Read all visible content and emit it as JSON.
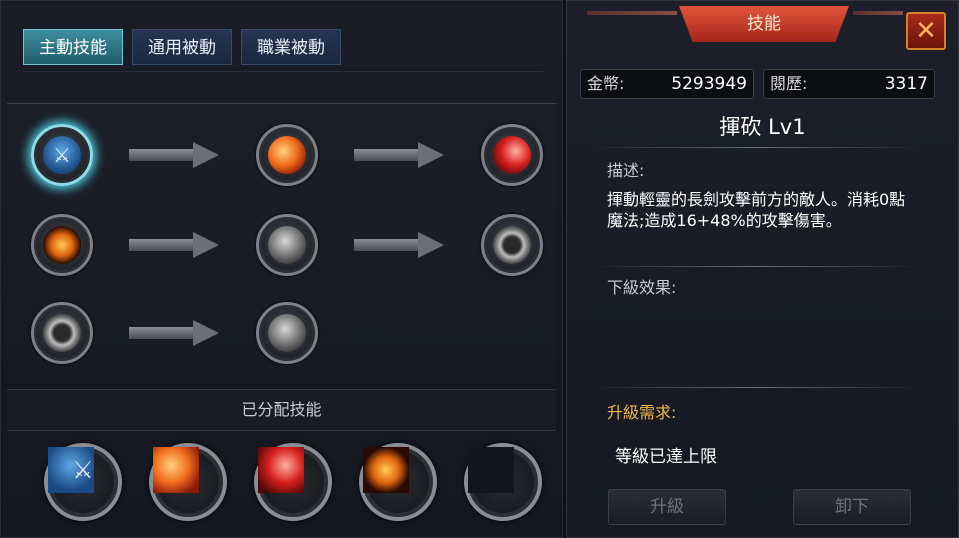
{
  "tabs": [
    {
      "label": "主動技能",
      "active": true
    },
    {
      "label": "通用被動",
      "active": false
    },
    {
      "label": "職業被動",
      "active": false
    }
  ],
  "skill_tree": {
    "rows": [
      [
        "sword",
        "fire",
        "slash"
      ],
      [
        "flame",
        "grey",
        "ring"
      ],
      [
        "ring",
        "grey"
      ]
    ],
    "selected": "sword"
  },
  "assigned_section": {
    "title": "已分配技能",
    "slots": [
      "sword",
      "fire",
      "slash",
      "flame",
      "empty"
    ]
  },
  "detail_panel": {
    "title": "技能",
    "close_icon": "close-icon",
    "gold_label": "金幣:",
    "gold_value": "5293949",
    "exp_label": "閱歷:",
    "exp_value": "3317",
    "skill_name": "揮砍 Lv1",
    "desc_label": "描述:",
    "desc_text": "揮動輕靈的長劍攻擊前方的敵人。消耗0點魔法;造成16+48%的攻擊傷害。",
    "next_label": "下級效果:",
    "req_label": "升級需求:",
    "req_value": "等級已達上限",
    "upgrade_button": "升級",
    "unequip_button": "卸下"
  },
  "colors": {
    "tab_active": "#3d8fa0",
    "tab_inactive": "#253552",
    "header_red": "#c23a28",
    "requirement_gold": "#f0b84a"
  }
}
